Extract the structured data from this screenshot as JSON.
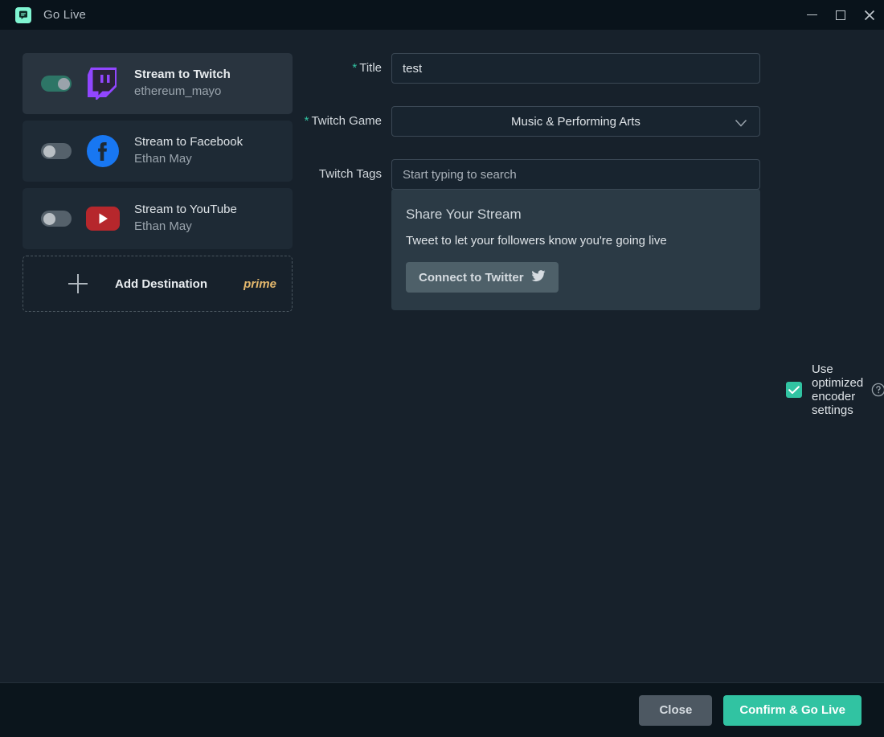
{
  "window": {
    "title": "Go Live",
    "logo_icon": "streamlabs-logo-icon",
    "controls": {
      "minimize": "minimize-icon",
      "maximize": "maximize-icon",
      "close": "close-icon"
    },
    "accent_color": "#31c3a2",
    "background_color": "#17212b",
    "titlebar_color": "#09131b"
  },
  "destinations": [
    {
      "platform": "twitch",
      "title": "Stream to Twitch",
      "account": "ethereum_mayo",
      "enabled": true,
      "icon": "twitch-icon",
      "brand_color": "#9146ff"
    },
    {
      "platform": "facebook",
      "title": "Stream to Facebook",
      "account": "Ethan May",
      "enabled": false,
      "icon": "facebook-icon",
      "brand_color": "#1877f2"
    },
    {
      "platform": "youtube",
      "title": "Stream to YouTube",
      "account": "Ethan May",
      "enabled": false,
      "icon": "youtube-icon",
      "brand_color": "#b6272c"
    }
  ],
  "add_destination": {
    "label": "Add Destination",
    "badge": "prime",
    "badge_color": "#e4b86d",
    "icon": "plus-icon"
  },
  "form": {
    "title_field": {
      "label": "Title",
      "required": true,
      "value": "test",
      "placeholder": ""
    },
    "game_field": {
      "label": "Twitch Game",
      "required": true,
      "value": "Music & Performing Arts",
      "chevron": "chevron-down-icon"
    },
    "tags_field": {
      "label": "Twitch Tags",
      "required": false,
      "value": "",
      "placeholder": "Start typing to search"
    }
  },
  "share_panel": {
    "title": "Share Your Stream",
    "subtitle": "Tweet to let your followers know you're going live",
    "button_label": "Connect to Twitter",
    "button_icon": "twitter-bird-icon"
  },
  "encoder": {
    "label": "Use optimized encoder settings",
    "checked": true,
    "help_icon": "help-circle-icon"
  },
  "footer": {
    "close_label": "Close",
    "confirm_label": "Confirm & Go Live"
  }
}
